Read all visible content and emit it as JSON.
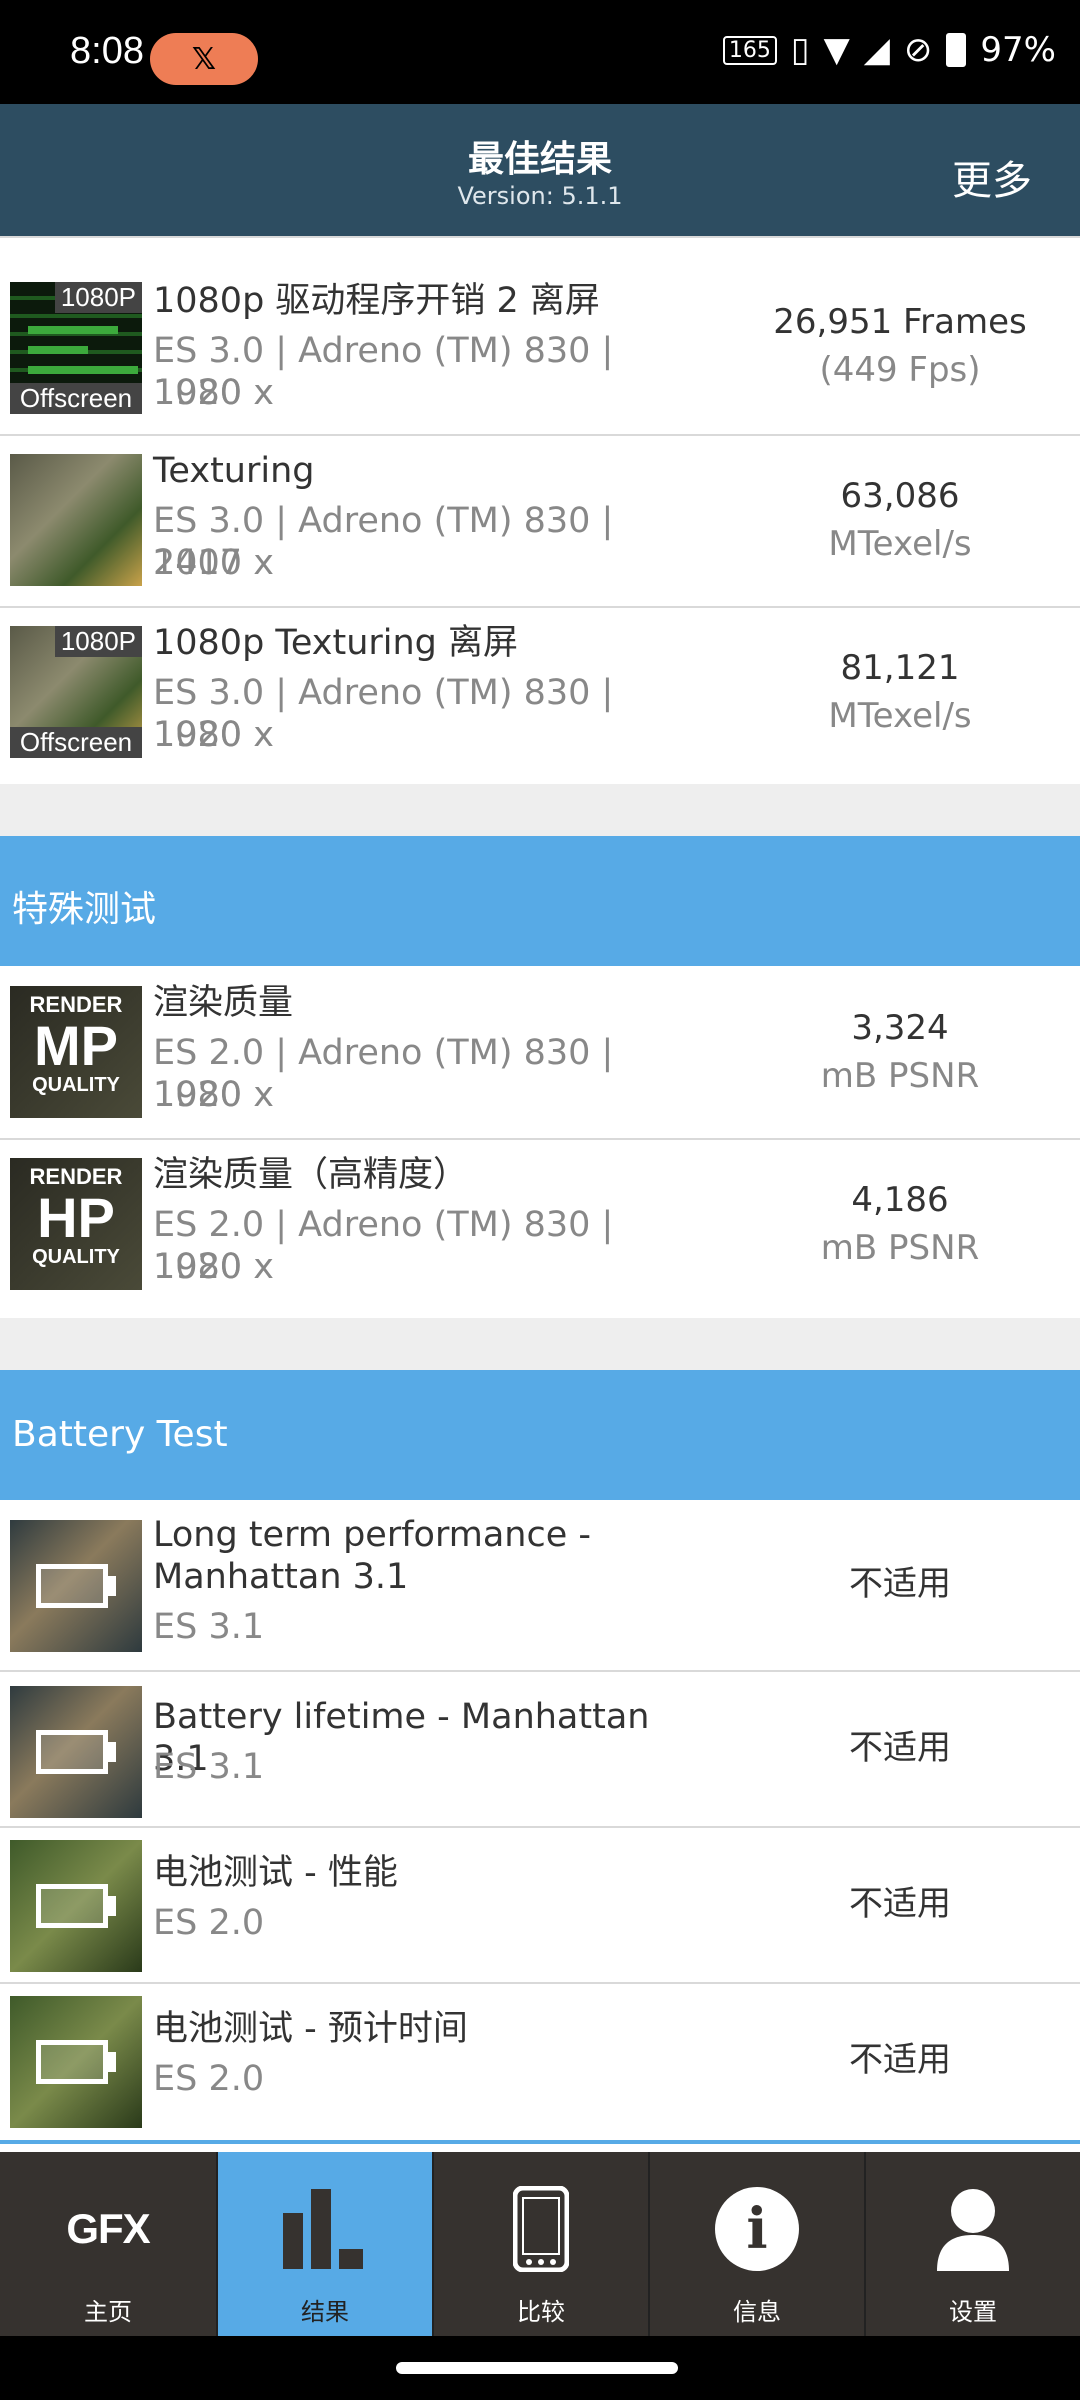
{
  "status_bar": {
    "time": "8:08",
    "battery": "97%"
  },
  "header": {
    "title": "最佳结果",
    "version": "Version: 5.1.1",
    "more_label": "更多"
  },
  "rows_top": [
    {
      "title": "1080p 驱动程序开销 2 离屏",
      "sub1": "ES 3.0 | Adreno (TM) 830 | 1920 x",
      "sub2": "1080",
      "val_a": "26,951 Frames",
      "val_b": "(449 Fps)",
      "badge": "1080P",
      "badge2": "Offscreen"
    },
    {
      "title": "Texturing",
      "sub1": "ES 3.0 | Adreno (TM) 830 | 2400 x",
      "sub2": "1017",
      "val_a": "63,086",
      "val_b": "MTexel/s"
    },
    {
      "title": "1080p Texturing 离屏",
      "sub1": "ES 3.0 | Adreno (TM) 830 | 1920 x",
      "sub2": "1080",
      "val_a": "81,121",
      "val_b": "MTexel/s",
      "badge": "1080P",
      "badge2": "Offscreen"
    }
  ],
  "section_special": {
    "label": "特殊测试"
  },
  "rows_special": [
    {
      "title": "渲染质量",
      "sub1": "ES 2.0 | Adreno (TM) 830 | 1920 x",
      "sub2": "1080",
      "val_a": "3,324",
      "val_b": "mB PSNR",
      "icon_top": "RENDER",
      "icon_mid": "MP",
      "icon_bot": "QUALITY"
    },
    {
      "title": "渲染质量（高精度）",
      "sub1": "ES 2.0 | Adreno (TM) 830 | 1920 x",
      "sub2": "1080",
      "val_a": "4,186",
      "val_b": "mB PSNR",
      "icon_top": "RENDER",
      "icon_mid": "HP",
      "icon_bot": "QUALITY"
    }
  ],
  "section_battery": {
    "label": "Battery Test"
  },
  "rows_battery": [
    {
      "title1": "Long term performance -",
      "title2": "Manhattan 3.1",
      "sub": "ES 3.1",
      "val": "不适用"
    },
    {
      "title": "Battery lifetime - Manhattan 3.1",
      "sub": "ES 3.1",
      "val": "不适用"
    },
    {
      "title": "电池测试 - 性能",
      "sub": "ES 2.0",
      "val": "不适用"
    },
    {
      "title": "电池测试 - 预计时间",
      "sub": "ES 2.0",
      "val": "不适用"
    }
  ],
  "partial_row": {
    "sub_tail": "1017"
  },
  "bottom_nav": [
    {
      "label": "主页",
      "icon": "gfx-logo-icon",
      "icon_text": "GFX"
    },
    {
      "label": "结果",
      "icon": "bar-chart-icon"
    },
    {
      "label": "比较",
      "icon": "phone-icon"
    },
    {
      "label": "信息",
      "icon": "info-icon",
      "icon_text": "i"
    },
    {
      "label": "设置",
      "icon": "user-icon"
    }
  ],
  "colors": {
    "header": "#2d4d61",
    "section": "#57aae6",
    "nav_bg": "#36322f",
    "pill": "#ee7d55"
  }
}
